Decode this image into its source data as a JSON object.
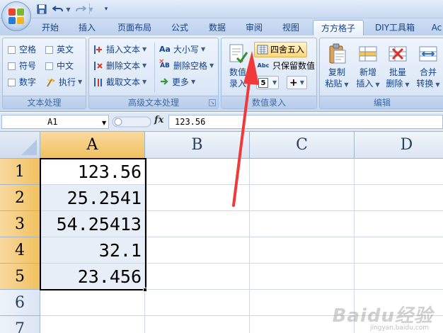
{
  "quick_access": {
    "save_icon": "save-icon",
    "undo_icon": "undo-icon",
    "redo_icon": "redo-icon",
    "customize_icon": "customize-qat-icon"
  },
  "tabs": [
    "开始",
    "插入",
    "页面布局",
    "公式",
    "数据",
    "审阅",
    "视图",
    "方方格子",
    "DIY工具箱",
    "Ac"
  ],
  "active_tab": "方方格子",
  "ribbon": {
    "text_processing": {
      "label": "文本处理",
      "checkboxes": [
        "空格",
        "英文",
        "符号",
        "中文",
        "数字"
      ],
      "execute_label": "执行"
    },
    "advanced_text": {
      "label": "高级文本处理",
      "insert_text": "插入文本",
      "delete_text": "删除文本",
      "extract_text": "截取文本",
      "case": "大小写",
      "delete_spaces": "删除空格",
      "more": "更多",
      "case_icon_text": "Aa",
      "delete_spaces_icon_text": "AB"
    },
    "numeric_entry": {
      "label": "数值录入",
      "entry_line1": "数值",
      "entry_line2": "录入",
      "round": "四舍五入",
      "keep_value": "只保留数值",
      "keep_value_icon_text": "Abc",
      "plus_label": "+"
    },
    "edit": {
      "label": "编辑",
      "copy_line1": "复制",
      "copy_line2": "粘贴",
      "add_line1": "新增",
      "add_line2": "插入",
      "batch_line1": "批量",
      "batch_line2": "删除",
      "merge_line1": "合并",
      "merge_line2": "转换"
    }
  },
  "formula_bar": {
    "name_box": "A1",
    "fx": "fx",
    "formula": "123.56"
  },
  "sheet": {
    "columns": [
      "A",
      "B",
      "C",
      "D"
    ],
    "rows": [
      "1",
      "2",
      "3",
      "4",
      "5",
      "6",
      "7"
    ],
    "cells_A": [
      "123.56",
      "25.2541",
      "54.25413",
      "32.1",
      "23.456",
      "",
      ""
    ]
  },
  "colors": {
    "annotation_arrow": "#f03a3a",
    "selection_header": "#f5c978",
    "ribbon_text": "#15428b"
  },
  "watermark": {
    "brand": "Baidu经验",
    "sub": "jingyan.baidu.com"
  }
}
